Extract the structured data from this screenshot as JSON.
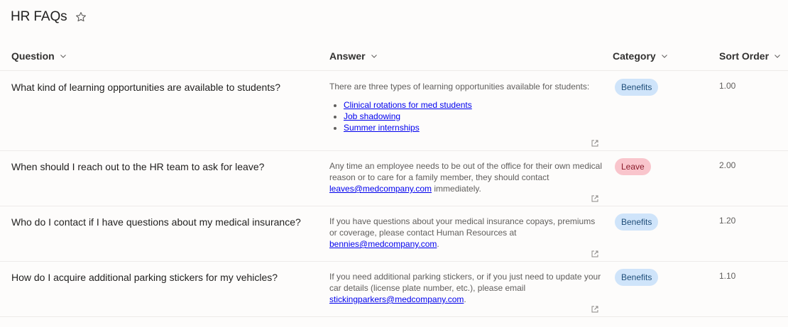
{
  "page": {
    "title": "HR FAQs",
    "favorite_icon": "star-outline-icon"
  },
  "columns": {
    "question": "Question",
    "answer": "Answer",
    "category": "Category",
    "sort_order": "Sort Order"
  },
  "rows": [
    {
      "question": "What kind of learning opportunities are available to students?",
      "answer_intro": "There are three types of learning opportunities available for students:",
      "answer_links": [
        "Clinical rotations for med students",
        "Job shadowing",
        "Summer internships"
      ],
      "category": "Benefits",
      "sort_order": "1.00"
    },
    {
      "question": "When should I reach out to the HR team to ask for leave?",
      "answer_before": "Any time an employee needs to be out of the office for their own medical reason or to care for a family member, they should contact ",
      "answer_link": "leaves@medcompany.com",
      "answer_after": " immediately.",
      "category": "Leave",
      "sort_order": "2.00"
    },
    {
      "question": "Who do I contact if I have questions about my medical insurance?",
      "answer_before": "If you have questions about your medical insurance copays, premiums or coverage, please contact Human Resources at ",
      "answer_link": "bennies@medcompany.com",
      "answer_after": ".",
      "category": "Benefits",
      "sort_order": "1.20"
    },
    {
      "question": "How do I acquire additional parking stickers for my vehicles?",
      "answer_before": "If you need additional parking stickers, or if you just need to update your car details (license plate number, etc.), please email ",
      "answer_link": "stickingparkers@medcompany.com",
      "answer_after": ".",
      "category": "Benefits",
      "sort_order": "1.10"
    }
  ],
  "colors": {
    "benefits_badge_bg": "#cfe4fa",
    "leave_badge_bg": "#f9c5cc",
    "link": "#0000ee"
  }
}
